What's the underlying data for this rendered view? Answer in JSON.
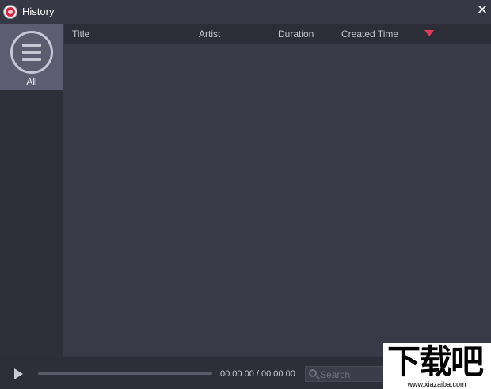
{
  "window": {
    "title": "History",
    "close_label": "✕"
  },
  "sidebar": {
    "categories": [
      {
        "label": "All",
        "icon": "list-icon",
        "selected": true
      }
    ]
  },
  "table": {
    "columns": [
      "Title",
      "Artist",
      "Duration",
      "Created Time"
    ],
    "sort_icon": "sort-desc-icon",
    "sort_color": "#e23a52",
    "rows": []
  },
  "player": {
    "time": "00:00:00 / 00:00:00",
    "progress": 0
  },
  "search": {
    "placeholder": "Search",
    "value": ""
  },
  "watermark": {
    "logo_text": "下载吧",
    "url": "www.xiazaiba.com"
  }
}
